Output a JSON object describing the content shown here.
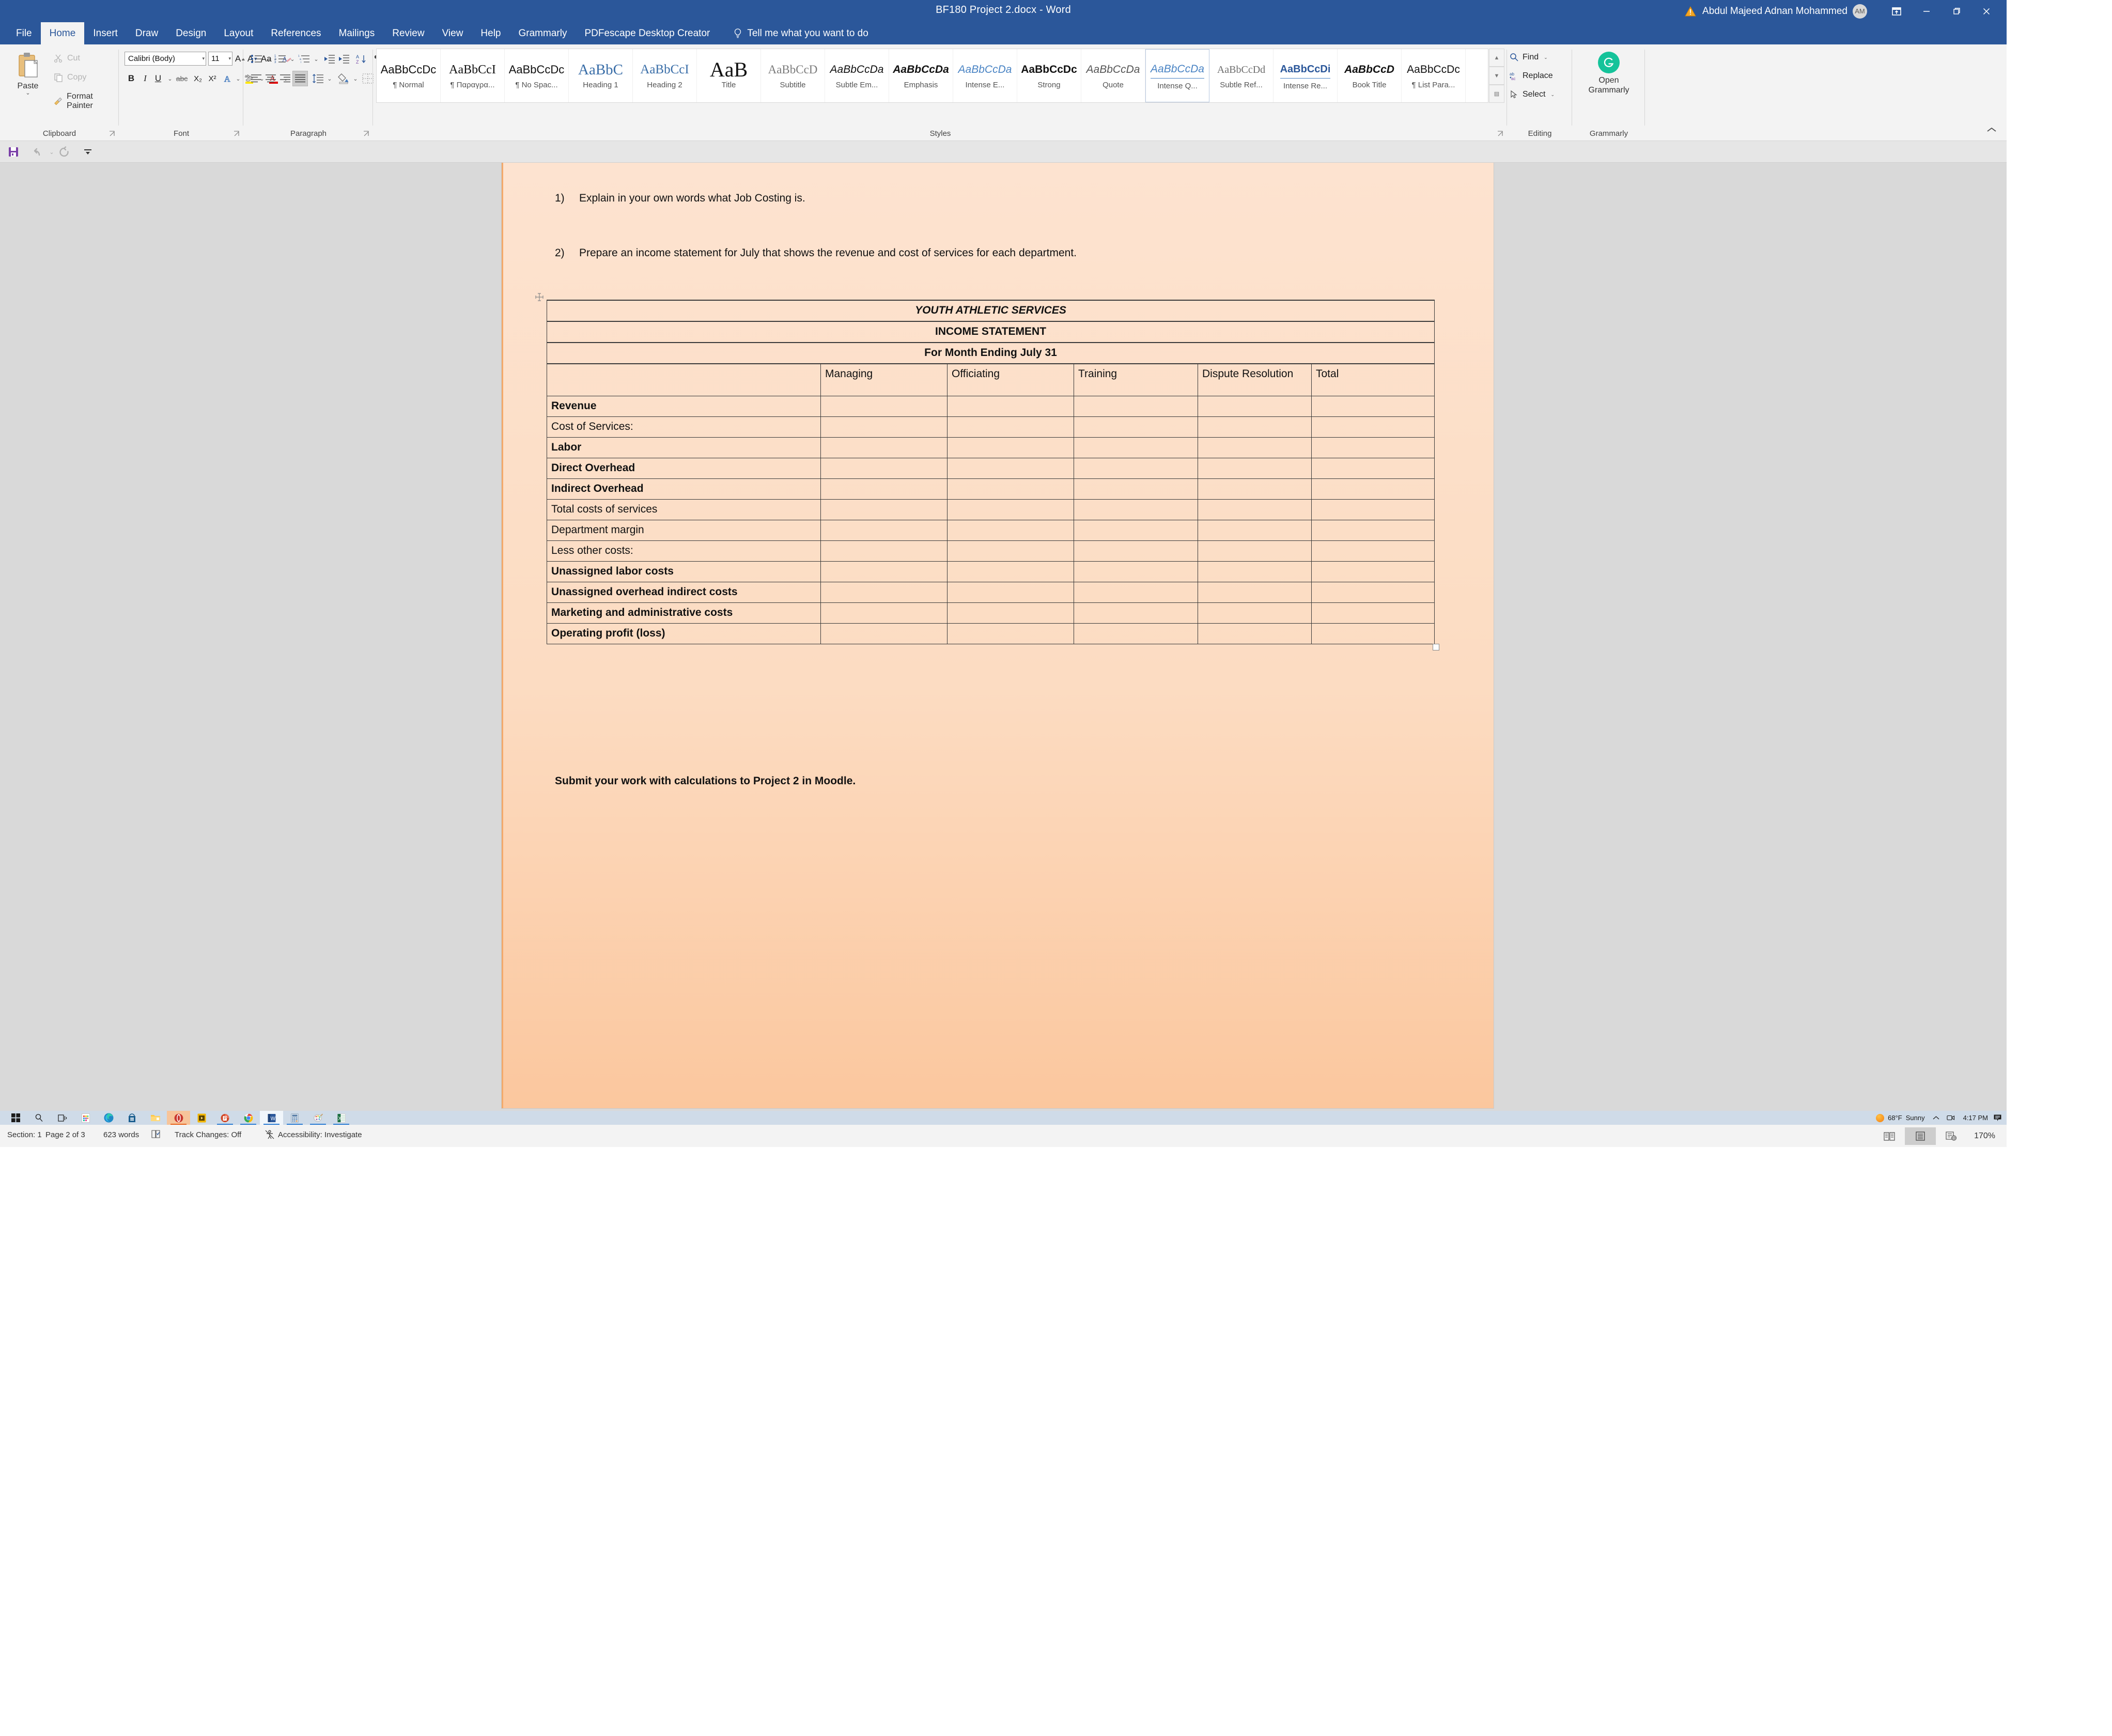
{
  "window": {
    "title": "BF180 Project 2.docx  -  Word",
    "user_name": "Abdul Majeed Adnan Mohammed",
    "avatar_initials": "AM",
    "warning_icon": "warning-triangle-icon",
    "ribbon_display_icon": "ribbon-display-options-icon",
    "minimize_icon": "minimize-icon",
    "restore_icon": "restore-icon",
    "close_icon": "close-icon",
    "accent_color": "#2b579a"
  },
  "quick_access": {
    "save_icon": "save-icon",
    "undo_icon": "undo-icon",
    "undo_caret_icon": "chevron-down-icon",
    "redo_icon": "redo-icon",
    "customize_icon": "customize-quick-access-icon"
  },
  "tabs": [
    {
      "label": "File",
      "active": false
    },
    {
      "label": "Home",
      "active": true
    },
    {
      "label": "Insert",
      "active": false
    },
    {
      "label": "Draw",
      "active": false
    },
    {
      "label": "Design",
      "active": false
    },
    {
      "label": "Layout",
      "active": false
    },
    {
      "label": "References",
      "active": false
    },
    {
      "label": "Mailings",
      "active": false
    },
    {
      "label": "Review",
      "active": false
    },
    {
      "label": "View",
      "active": false
    },
    {
      "label": "Help",
      "active": false
    },
    {
      "label": "Grammarly",
      "active": false
    },
    {
      "label": "PDFescape Desktop Creator",
      "active": false
    }
  ],
  "tell_me": {
    "label": "Tell me what you want to do",
    "icon": "lightbulb-icon"
  },
  "ribbon": {
    "clipboard": {
      "group_label": "Clipboard",
      "paste_label": "Paste",
      "cut_label": "Cut",
      "copy_label": "Copy",
      "format_painter_label": "Format Painter"
    },
    "font": {
      "group_label": "Font",
      "font_name": "Calibri (Body)",
      "font_size": "11",
      "grow_font_icon": "grow-font-icon",
      "shrink_font_icon": "shrink-font-icon",
      "change_case_label": "Aa",
      "clear_formatting_icon": "clear-formatting-icon",
      "bold_label": "B",
      "italic_label": "I",
      "underline_label": "U",
      "strikethrough_label": "abc",
      "subscript_label": "X₂",
      "superscript_label": "X²",
      "text_effects_label": "A",
      "highlight_label": "ab",
      "font_color_label": "A"
    },
    "paragraph": {
      "group_label": "Paragraph",
      "bullets_icon": "bullet-list-icon",
      "numbering_icon": "numbered-list-icon",
      "multilevel_icon": "multilevel-list-icon",
      "decrease_indent_icon": "decrease-indent-icon",
      "increase_indent_icon": "increase-indent-icon",
      "sort_icon": "sort-az-icon",
      "show_marks_icon": "pilcrow-icon",
      "align_left_icon": "align-left-icon",
      "align_center_icon": "align-center-icon",
      "align_right_icon": "align-right-icon",
      "justify_icon": "justify-icon",
      "line_spacing_icon": "line-spacing-icon",
      "shading_icon": "shading-icon",
      "borders_icon": "borders-icon"
    },
    "styles": {
      "group_label": "Styles",
      "items": [
        {
          "sample": "AaBbCcDc",
          "name": "¶ Normal"
        },
        {
          "sample": "AaBbCcI",
          "name": "¶ Παραγρα..."
        },
        {
          "sample": "AaBbCcDc",
          "name": "¶ No Spac..."
        },
        {
          "sample": "AaBbC",
          "name": "Heading 1"
        },
        {
          "sample": "AaBbCcI",
          "name": "Heading 2"
        },
        {
          "sample": "AaB",
          "name": "Title"
        },
        {
          "sample": "AaBbCcD",
          "name": "Subtitle"
        },
        {
          "sample": "AaBbCcDa",
          "name": "Subtle Em..."
        },
        {
          "sample": "AaBbCcDa",
          "name": "Emphasis"
        },
        {
          "sample": "AaBbCcDa",
          "name": "Intense E..."
        },
        {
          "sample": "AaBbCcDc",
          "name": "Strong"
        },
        {
          "sample": "AaBbCcDa",
          "name": "Quote"
        },
        {
          "sample": "AaBbCcDa",
          "name": "Intense Q..."
        },
        {
          "sample": "AaBbCcDd",
          "name": "Subtle Ref..."
        },
        {
          "sample": "AaBbCcDi",
          "name": "Intense Re..."
        },
        {
          "sample": "AaBbCcD",
          "name": "Book Title"
        },
        {
          "sample": "AaBbCcDc",
          "name": "¶ List Para..."
        }
      ],
      "scroll_up_icon": "scroll-up-icon",
      "scroll_down_icon": "scroll-down-icon",
      "more_styles_icon": "more-styles-icon"
    },
    "editing": {
      "group_label": "Editing",
      "find_label": "Find",
      "replace_label": "Replace",
      "select_label": "Select",
      "find_icon": "search-icon",
      "replace_icon": "replace-icon",
      "select_icon": "cursor-icon"
    },
    "grammarly": {
      "group_label": "Grammarly",
      "button_line1": "Open",
      "button_line2": "Grammarly",
      "logo_icon": "grammarly-logo-icon",
      "logo_color": "#15c39a"
    },
    "collapse_icon": "collapse-ribbon-icon"
  },
  "document": {
    "page_color": "#fde0cb",
    "questions": [
      {
        "index": "1)",
        "text": "Explain in your own words what Job Costing is."
      },
      {
        "index": "2)",
        "text": "Prepare an income statement for July that shows the revenue and cost of services for each department."
      }
    ],
    "table_handle_icon": "table-move-handle-icon",
    "table_resize_icon": "table-resize-handle-icon",
    "table": {
      "title_rows": [
        "YOUTH ATHLETIC SERVICES",
        "INCOME STATEMENT",
        "For Month Ending July 31"
      ],
      "column_headers": [
        "",
        "Managing",
        "Officiating",
        "Training",
        "Dispute Resolution",
        "Total"
      ],
      "rows": [
        {
          "label": "Revenue",
          "bold": true,
          "indent": 0
        },
        {
          "label": "Cost of Services:",
          "bold": false,
          "indent": 0
        },
        {
          "label": "Labor",
          "bold": true,
          "indent": 1
        },
        {
          "label": "Direct Overhead",
          "bold": true,
          "indent": 1
        },
        {
          "label": "Indirect Overhead",
          "bold": true,
          "indent": 1
        },
        {
          "label": "Total costs of services",
          "bold": false,
          "indent": 2
        },
        {
          "label": "Department margin",
          "bold": false,
          "indent": 0
        },
        {
          "label": "Less other costs:",
          "bold": false,
          "indent": 0
        },
        {
          "label": "Unassigned labor costs",
          "bold": true,
          "indent": 1
        },
        {
          "label": "Unassigned overhead indirect costs",
          "bold": true,
          "indent": 1
        },
        {
          "label": "Marketing and administrative costs",
          "bold": true,
          "indent": 1
        },
        {
          "label": "Operating profit (loss)",
          "bold": true,
          "indent": 0
        }
      ]
    },
    "submit_note": "Submit your work with calculations to Project 2 in Moodle."
  },
  "status_bar": {
    "section": "Section: 1",
    "page": "Page 2 of 3",
    "words": "623 words",
    "proofing_icon": "proofing-errors-icon",
    "track_changes": "Track Changes: Off",
    "accessibility": "Accessibility: Investigate",
    "accessibility_icon": "accessibility-icon",
    "view_read_icon": "read-mode-icon",
    "view_print_icon": "print-layout-icon",
    "view_web_icon": "web-layout-icon",
    "zoom": "170%"
  },
  "taskbar": {
    "items": [
      {
        "name": "start-button-icon",
        "state": "idle"
      },
      {
        "name": "search-icon",
        "state": "idle"
      },
      {
        "name": "task-view-icon",
        "state": "idle"
      },
      {
        "name": "widgets-icon",
        "state": "idle"
      },
      {
        "name": "microsoft-edge-icon",
        "state": "idle"
      },
      {
        "name": "microsoft-store-icon",
        "state": "idle"
      },
      {
        "name": "file-explorer-icon",
        "state": "idle"
      },
      {
        "name": "opera-gx-icon",
        "state": "active"
      },
      {
        "name": "media-player-icon",
        "state": "running"
      },
      {
        "name": "powerpoint-icon",
        "state": "running"
      },
      {
        "name": "google-chrome-icon",
        "state": "running"
      },
      {
        "name": "microsoft-word-icon",
        "state": "focused"
      },
      {
        "name": "calculator-icon",
        "state": "running"
      },
      {
        "name": "paint-icon",
        "state": "running"
      },
      {
        "name": "microsoft-excel-icon",
        "state": "running"
      }
    ],
    "weather_temp": "68°F",
    "weather_desc": "Sunny",
    "weather_icon": "sun-icon",
    "tray_expand_icon": "chevron-up-icon",
    "meet_now_icon": "meet-now-icon",
    "clock": "4:17 PM",
    "notifications_icon": "notifications-icon"
  }
}
